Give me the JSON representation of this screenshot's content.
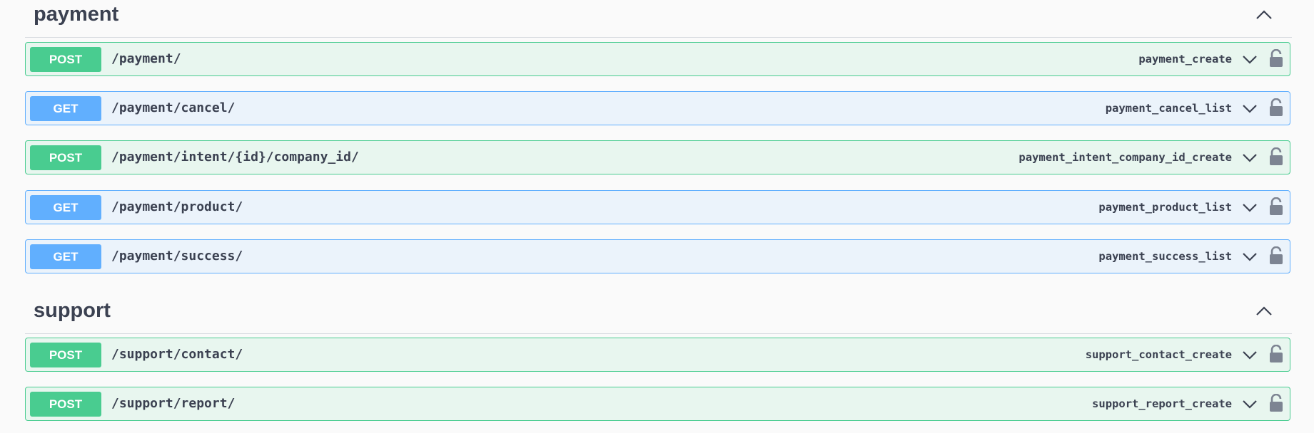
{
  "sections": [
    {
      "title": "payment",
      "operations": [
        {
          "method": "POST",
          "path": "/payment/",
          "operation_id": "payment_create"
        },
        {
          "method": "GET",
          "path": "/payment/cancel/",
          "operation_id": "payment_cancel_list"
        },
        {
          "method": "POST",
          "path": "/payment/intent/{id}/company_id/",
          "operation_id": "payment_intent_company_id_create"
        },
        {
          "method": "GET",
          "path": "/payment/product/",
          "operation_id": "payment_product_list"
        },
        {
          "method": "GET",
          "path": "/payment/success/",
          "operation_id": "payment_success_list"
        }
      ]
    },
    {
      "title": "support",
      "operations": [
        {
          "method": "POST",
          "path": "/support/contact/",
          "operation_id": "support_contact_create"
        },
        {
          "method": "POST",
          "path": "/support/report/",
          "operation_id": "support_report_create"
        }
      ]
    }
  ],
  "icons": {
    "section_toggle": "chevron-up-icon",
    "expand": "chevron-down-icon",
    "auth": "lock-open-icon"
  },
  "colors": {
    "post": "#49cc90",
    "get": "#61affe",
    "text": "#3b4151",
    "lock": "#7d8492"
  }
}
